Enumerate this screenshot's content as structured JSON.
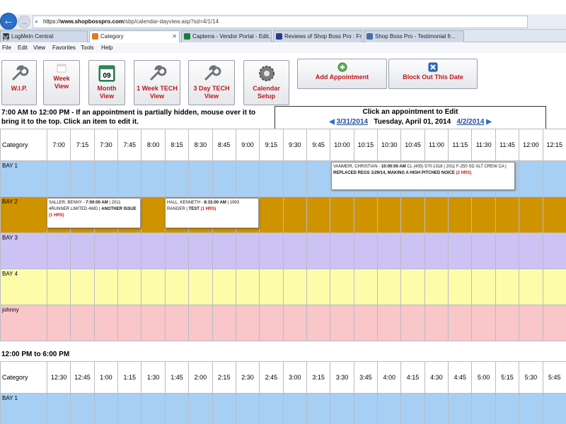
{
  "browser": {
    "url_proto": "https://",
    "url_host": "www.shopbosspro.com",
    "url_path": "/sbp/calendar-dayview.asp?sd=4/1/14",
    "tabs": [
      {
        "label": "LogMeIn Central",
        "icon_color": "#3a3a3a",
        "closable": false
      },
      {
        "label": "Category",
        "icon_color": "#e07a1c",
        "closable": true
      },
      {
        "label": "Capterra - Vendor Portal - Edit...",
        "icon_color": "#1f7a3a",
        "closable": false
      },
      {
        "label": "Reviews of Shop Boss Pro : Fre...",
        "icon_color": "#2c3a8c",
        "closable": false
      },
      {
        "label": "Shop Boss Pro - Testimonial fr...",
        "icon_color": "#4a6fa5",
        "closable": false
      }
    ],
    "menu": [
      "File",
      "Edit",
      "View",
      "Favorites",
      "Tools",
      "Help"
    ]
  },
  "toolbar": {
    "buttons": [
      {
        "label": "W.I.P.",
        "icon": "wrench-icon"
      },
      {
        "label": "Week View",
        "icon": "calendar-week-icon"
      },
      {
        "label": "Month View",
        "icon": "calendar-day-icon",
        "icon_text": "09"
      },
      {
        "label": "1 Week TECH View",
        "icon": "wrench-icon"
      },
      {
        "label": "3 Day TECH View",
        "icon": "wrench-icon"
      },
      {
        "label": "Calendar Setup",
        "icon": "gear-icon"
      },
      {
        "label": "Add Appointment",
        "icon": "plus-circle-icon"
      },
      {
        "label": "Block Out This Date",
        "icon": "block-icon"
      }
    ]
  },
  "info": {
    "instructions": "7:00 AM to 12:00 PM - If an appointment is partially hidden, mouse over it to bring it to the top.  Click an item to edit it.",
    "click_hint": "Click an appointment to Edit",
    "prev_date": "3/31/2014",
    "current_date": "Tuesday, April 01, 2014",
    "next_date": "4/2/2014"
  },
  "morning": {
    "category_label": "Category",
    "times": [
      "7:00",
      "7:15",
      "7:30",
      "7:45",
      "8:00",
      "8:15",
      "8:30",
      "8:45",
      "9:00",
      "9:15",
      "9:30",
      "9:45",
      "10:00",
      "10:15",
      "10:30",
      "10:45",
      "11:00",
      "11:15",
      "11:30",
      "11:45",
      "12:00",
      "12:15"
    ],
    "rows": [
      "BAY 1",
      "BAY 2",
      "BAY 3",
      "BAY 4",
      "johnny"
    ]
  },
  "afternoon": {
    "title": "12:00 PM to 6:00 PM",
    "category_label": "Category",
    "times": [
      "12:30",
      "12:45",
      "1:00",
      "1:15",
      "1:30",
      "1:45",
      "2:00",
      "2:15",
      "2:30",
      "2:45",
      "3:00",
      "3:15",
      "3:30",
      "3:45",
      "4:00",
      "4:15",
      "4:30",
      "4:45",
      "5:00",
      "5:15",
      "5:30",
      "5:45"
    ],
    "rows": [
      "BAY 1"
    ]
  },
  "appointments": [
    {
      "customer": "VANMEIR, CHRISTIAN",
      "time": "10:00:00 AM",
      "phone": "CL (405) 570-1318",
      "vehicle": "| 2011 F-250 SD XLT CREW CA |",
      "description": "REPLACED REGS 1/29/14, MAKING A HIGH PITCHED NOICE",
      "hours": "(2 HRS)"
    },
    {
      "customer": "SALLER, BENNY",
      "time": "7:00:00 AM",
      "phone": "",
      "vehicle": "| 2011 4RUNNER LIMITED 4WD |",
      "description": "ANOTHER ISSUE",
      "hours": "(1 HRS)"
    },
    {
      "customer": "HALL, KENNETH",
      "time": "8:15:00 AM",
      "phone": "",
      "vehicle": "| 1993 RANGER |",
      "description": "TEST",
      "hours": "(1 HRS)"
    }
  ],
  "colors": {
    "bay1": "#a7cff4",
    "bay2": "#cf9300",
    "bay3": "#ccc3f4",
    "bay4": "#fdfca8",
    "johnny": "#f9c6c9",
    "button_text": "#c0161c",
    "link": "#1f4ea6"
  }
}
